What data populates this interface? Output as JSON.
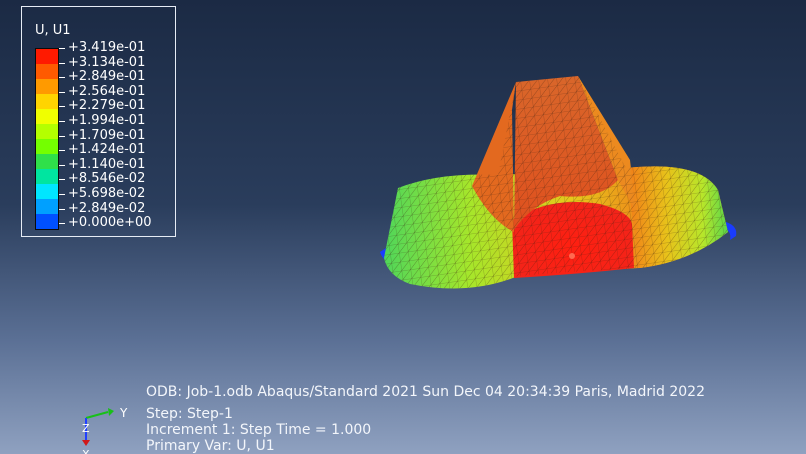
{
  "legend": {
    "title": "U, U1",
    "labels": [
      "+3.419e-01",
      "+3.134e-01",
      "+2.849e-01",
      "+2.564e-01",
      "+2.279e-01",
      "+1.994e-01",
      "+1.709e-01",
      "+1.424e-01",
      "+1.140e-01",
      "+8.546e-02",
      "+5.698e-02",
      "+2.849e-02",
      "+0.000e+00"
    ],
    "colors": [
      "#ff1a00",
      "#ff5a00",
      "#ff9a00",
      "#ffd400",
      "#f0ff00",
      "#b4ff00",
      "#74ff00",
      "#2fe04a",
      "#00e5a0",
      "#00e6ff",
      "#00a0ff",
      "#0050ff",
      "#0010d0"
    ]
  },
  "info": {
    "odb": "ODB: Job-1.odb    Abaqus/Standard 2021    Sun Dec 04 20:34:39 Paris, Madrid 2022",
    "step": "Step: Step-1",
    "increment": "Increment      1: Step Time =      1.000",
    "primary_var": "Primary Var: U, U1"
  },
  "triad": {
    "y_label": "Y",
    "z_label": "Z",
    "x_label": "X"
  }
}
